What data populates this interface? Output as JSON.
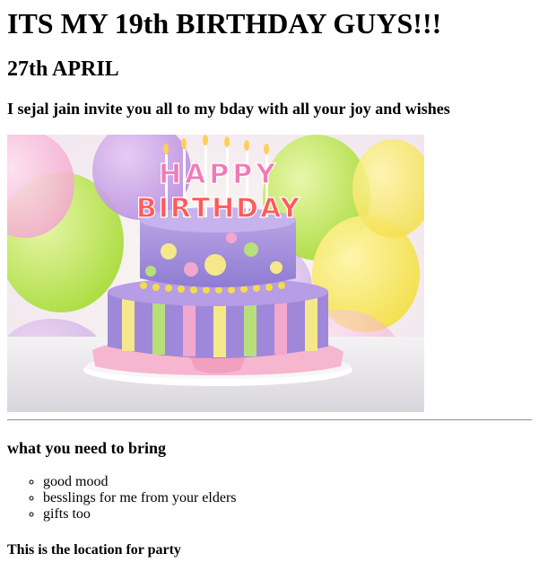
{
  "page": {
    "title": "ITS MY 19th BIRTHDAY GUYS!!!",
    "date": "27th APRIL",
    "invite": "I sejal jain invite you all to my bday with all your joy and wishes",
    "image": {
      "topper_line1": "HAPPY",
      "topper_line2": "BIRTHDAY"
    },
    "bring_heading": "what you need to bring",
    "bring_items": [
      "good mood",
      "besslings for me from your elders",
      "gifts too"
    ],
    "location_heading": "This is the location for party"
  }
}
